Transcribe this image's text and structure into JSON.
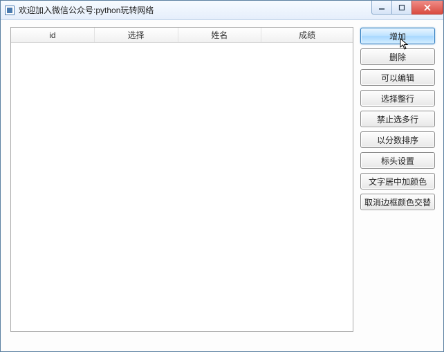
{
  "window": {
    "title": "欢迎加入微信公众号:python玩转网络"
  },
  "table": {
    "columns": [
      "id",
      "选择",
      "姓名",
      "成绩"
    ]
  },
  "buttons": [
    {
      "label": "增加",
      "active": true
    },
    {
      "label": "删除",
      "active": false
    },
    {
      "label": "可以编辑",
      "active": false
    },
    {
      "label": "选择整行",
      "active": false
    },
    {
      "label": "禁止选多行",
      "active": false
    },
    {
      "label": "以分数排序",
      "active": false
    },
    {
      "label": "标头设置",
      "active": false
    },
    {
      "label": "文字居中加颜色",
      "active": false
    },
    {
      "label": "取消边框颜色交替",
      "active": false
    }
  ]
}
